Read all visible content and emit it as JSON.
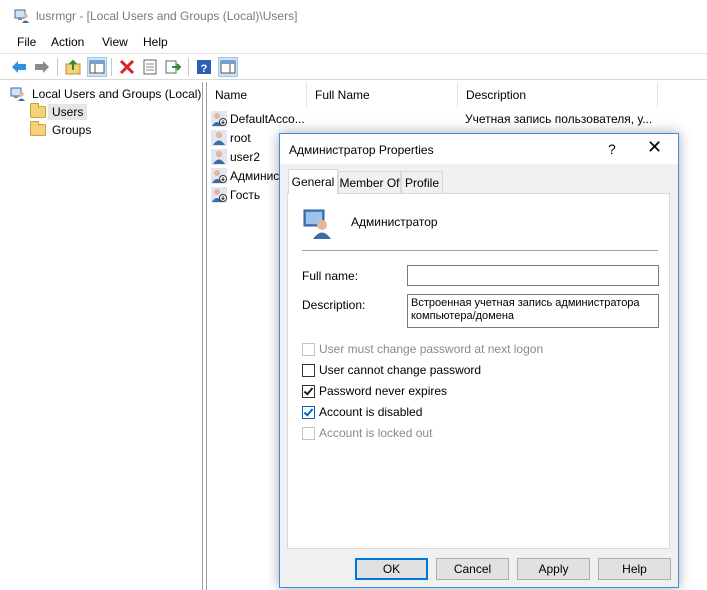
{
  "window": {
    "title": "lusrmgr - [Local Users and Groups (Local)\\Users]",
    "icon": "computer-users-icon"
  },
  "menu": [
    "File",
    "Action",
    "View",
    "Help"
  ],
  "toolbar": {
    "buttons": [
      "back-arrow-icon",
      "forward-arrow-icon",
      "up-folder-icon",
      "show-hide-tree-icon",
      "delete-icon",
      "properties-icon",
      "export-list-icon",
      "help-icon",
      "action-pane-icon"
    ]
  },
  "tree": {
    "root": "Local Users and Groups (Local)",
    "children": [
      "Users",
      "Groups"
    ],
    "selected": "Users"
  },
  "list": {
    "columns": [
      "Name",
      "Full Name",
      "Description"
    ],
    "rows": [
      {
        "name": "DefaultAcco...",
        "full_name": "",
        "description": "Учетная запись пользователя, у..."
      },
      {
        "name": "root",
        "full_name": "",
        "description": ""
      },
      {
        "name": "user2",
        "full_name": "",
        "description": ""
      },
      {
        "name": "Админис",
        "full_name": "",
        "description": ""
      },
      {
        "name": "Гость",
        "full_name": "",
        "description": ""
      }
    ]
  },
  "dialog": {
    "title": "Администратор Properties",
    "help_glyph": "?",
    "close_glyph": "✕",
    "tabs": [
      "General",
      "Member Of",
      "Profile"
    ],
    "active_tab": "General",
    "user_name": "Администратор",
    "full_name_label": "Full name:",
    "full_name_value": "",
    "description_label": "Description:",
    "description_value": "Встроенная учетная запись администратора компьютера/домена",
    "checkboxes": [
      {
        "label": "User must change password at next logon",
        "checked": false,
        "enabled": false
      },
      {
        "label": "User cannot change password",
        "checked": false,
        "enabled": true
      },
      {
        "label": "Password never expires",
        "checked": true,
        "enabled": true
      },
      {
        "label": "Account is disabled",
        "checked": true,
        "enabled": true
      },
      {
        "label": "Account is locked out",
        "checked": false,
        "enabled": false
      }
    ],
    "buttons": {
      "ok": "OK",
      "cancel": "Cancel",
      "apply": "Apply",
      "help": "Help"
    }
  }
}
